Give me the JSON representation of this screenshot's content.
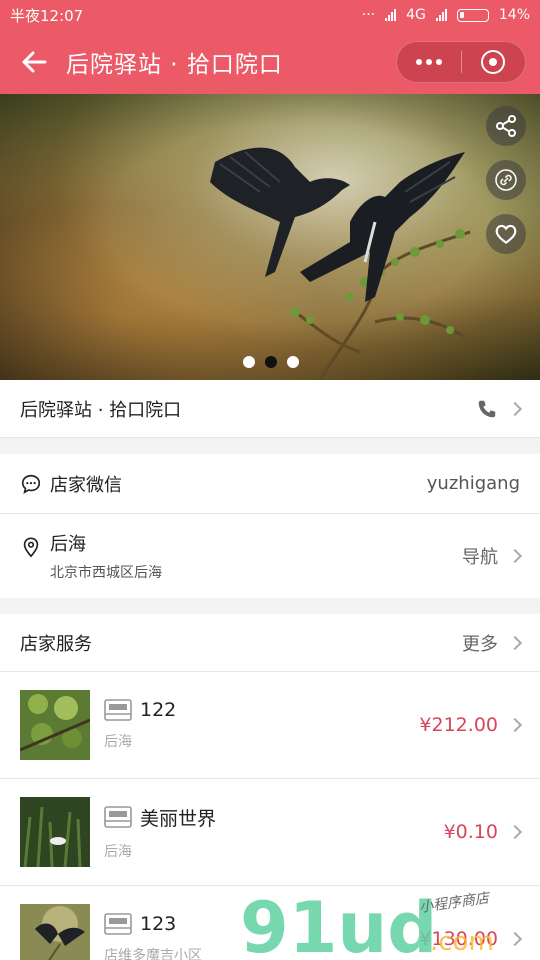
{
  "status": {
    "time": "半夜12:07",
    "network": "4G",
    "battery": "14%"
  },
  "nav": {
    "title": "后院驿站 · 拾口院口"
  },
  "shop": {
    "name": "后院驿站 · 拾口院口"
  },
  "wechat": {
    "label": "店家微信",
    "value": "yuzhigang"
  },
  "address": {
    "name": "后海",
    "detail": "北京市西城区后海",
    "action": "导航"
  },
  "services": {
    "title": "店家服务",
    "more": "更多",
    "items": [
      {
        "name": "122",
        "location": "后海",
        "price": "¥212.00"
      },
      {
        "name": "美丽世界",
        "location": "后海",
        "price": "¥0.10"
      },
      {
        "name": "123",
        "location": "店维多魔吉小区",
        "price": "¥130.00"
      }
    ]
  },
  "watermark": {
    "brand": "91ud",
    "sub": "小程序商店",
    "domain": ".com"
  },
  "colors": {
    "accent": "#eb5a66",
    "price": "#d6475a"
  },
  "icons": [
    "back-arrow-icon",
    "more-dots-icon",
    "target-icon",
    "share-icon",
    "link-icon",
    "heart-icon",
    "phone-icon",
    "chat-bubble-icon",
    "location-pin-icon",
    "bed-icon",
    "chevron-right-icon"
  ]
}
